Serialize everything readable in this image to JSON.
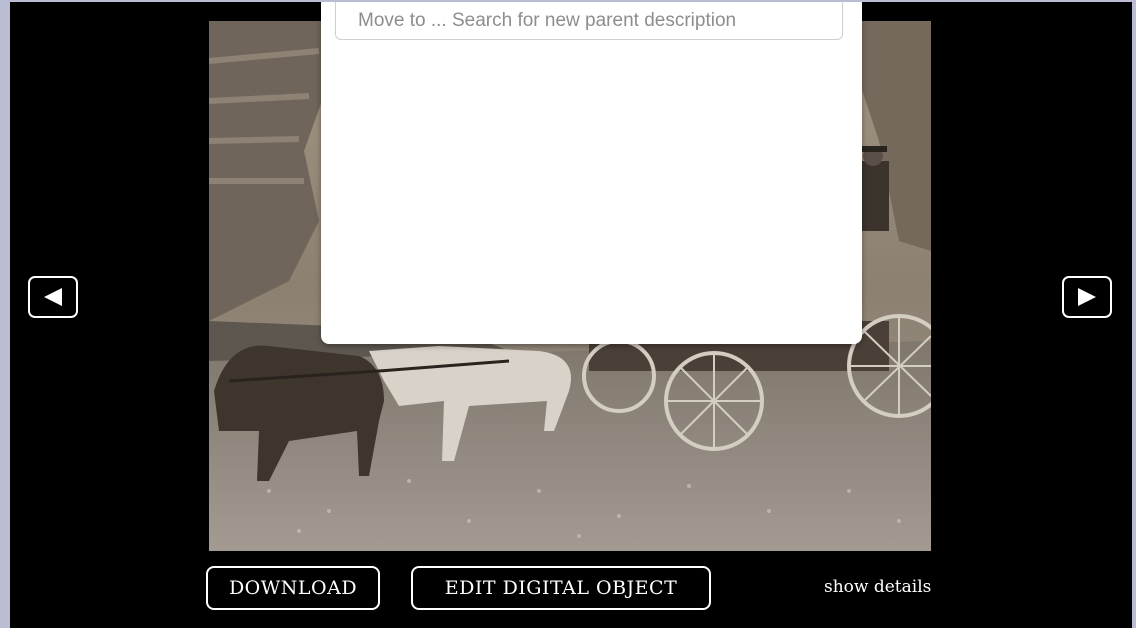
{
  "viewer": {
    "prev_icon": "triangle-left-icon",
    "next_icon": "triangle-right-icon",
    "image_description": "sepia photograph of a horse-drawn wagon crossing a stream"
  },
  "move_dialog": {
    "search_placeholder": "Move to ... Search for new parent description"
  },
  "actions": {
    "download_label": "DOWNLOAD",
    "edit_label": "EDIT DIGITAL OBJECT",
    "show_details_label": "show details"
  },
  "colors": {
    "background": "#000000",
    "page_border": "#b9bcd2",
    "button_border": "#ffffff",
    "panel": "#ffffff"
  }
}
